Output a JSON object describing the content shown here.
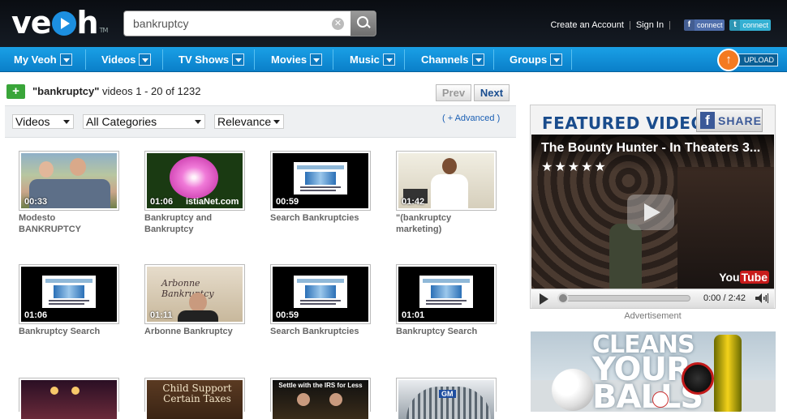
{
  "header": {
    "logo_text": "veoh",
    "logo_mark": "TM",
    "search_value": "bankruptcy",
    "links": [
      "Create an Account",
      "Sign In"
    ],
    "connect_label": "connect"
  },
  "nav": {
    "items": [
      "My Veoh",
      "Videos",
      "TV Shows",
      "Movies",
      "Music",
      "Channels",
      "Groups"
    ],
    "upload_label": "UPLOAD"
  },
  "results": {
    "add_label": "+",
    "query": "\"bankruptcy\"",
    "summary": "videos  1 - 20 of 1232",
    "prev_label": "Prev",
    "next_label": "Next"
  },
  "filters": {
    "type": "Videos",
    "category": "All Categories",
    "sort": "Relevance",
    "advanced_label": "( + Advanced )"
  },
  "videos": [
    {
      "duration": "00:33",
      "title_lines": [
        "Modesto",
        "BANKRUPTCY"
      ]
    },
    {
      "duration": "01:06",
      "title_lines": [
        "Bankruptcy and",
        "Bankruptcy"
      ],
      "overlay": "istiaNet.com"
    },
    {
      "duration": "00:59",
      "title_lines": [
        "Search Bankruptcies",
        ""
      ]
    },
    {
      "duration": "01:42",
      "title_lines": [
        "\"(bankruptcy",
        "marketing)"
      ]
    },
    {
      "duration": "01:06",
      "title_lines": [
        "Bankruptcy Search",
        ""
      ]
    },
    {
      "duration": "01:11",
      "title_lines": [
        "Arbonne Bankruptcy",
        ""
      ],
      "overlay": "Arbonne Bankruptcy"
    },
    {
      "duration": "00:59",
      "title_lines": [
        "Search Bankruptcies",
        ""
      ]
    },
    {
      "duration": "01:01",
      "title_lines": [
        "Bankruptcy Search",
        ""
      ]
    },
    {
      "duration": "",
      "title_lines": [
        "",
        ""
      ]
    },
    {
      "duration": "",
      "title_lines": [
        "",
        ""
      ],
      "overlay": "Child Support Certain Taxes"
    },
    {
      "duration": "",
      "title_lines": [
        "",
        ""
      ],
      "overlay": "Settle with the IRS for Less"
    },
    {
      "duration": "",
      "title_lines": [
        "",
        ""
      ],
      "overlay": "GM"
    }
  ],
  "featured": {
    "heading": "FEATURED VIDEO",
    "share_label": "SHARE",
    "video_title": "The Bounty Hunter - In Theaters 3...",
    "rating_stars": "★★★★★",
    "time": "0:00 / 2:42",
    "watermark": "YouTube",
    "advertisement_label": "Advertisement",
    "ad_text_lines": [
      "CLEANS",
      "YOUR",
      "BALLS"
    ]
  }
}
